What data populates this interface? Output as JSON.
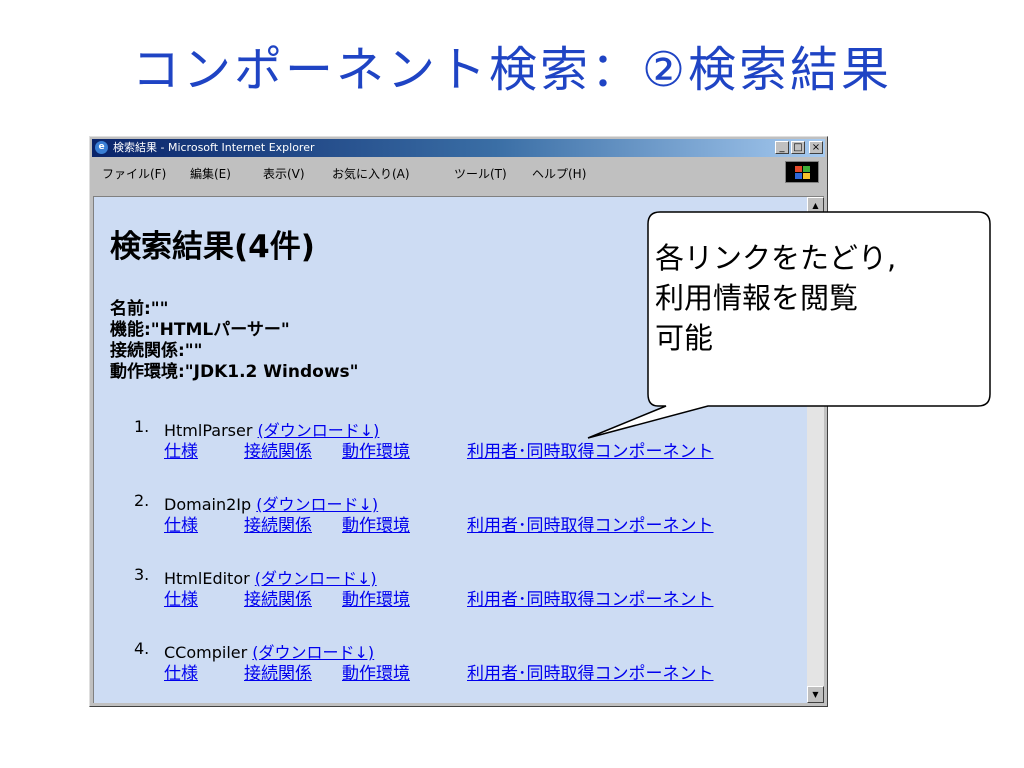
{
  "slide_title": "コンポーネント検索：②検索結果",
  "window": {
    "title": "検索結果 - Microsoft Internet Explorer",
    "controls": [
      "_",
      "□",
      "×"
    ],
    "menu": [
      "ファイル(F)",
      "編集(E)",
      "表示(V)",
      "お気に入り(A)",
      "ツール(T)",
      "ヘルプ(H)"
    ]
  },
  "page": {
    "heading": "検索結果(4件)",
    "criteria": [
      "名前:\"\"",
      "機能:\"HTMLパーサー\"",
      "接続関係:\"\"",
      "動作環境:\"JDK1.2 Windows\""
    ]
  },
  "results": [
    {
      "num": "1.",
      "name": "HtmlParser",
      "download": "(ダウンロード↓)"
    },
    {
      "num": "2.",
      "name": "Domain2Ip",
      "download": "(ダウンロード↓)"
    },
    {
      "num": "3.",
      "name": "HtmlEditor",
      "download": "(ダウンロード↓)"
    },
    {
      "num": "4.",
      "name": "CCompiler",
      "download": "(ダウンロード↓)"
    }
  ],
  "result_links": {
    "spec": "仕様",
    "connection": "接続関係",
    "env": "動作環境",
    "users": "利用者･同時取得コンポーネント"
  },
  "callout": {
    "lines": [
      "各リンクをたどり,",
      "利用情報を閲覧",
      "可能"
    ]
  },
  "colors": {
    "title": "#1f44c4",
    "content_bg": "#cddcf3",
    "link": "#0000ee"
  }
}
